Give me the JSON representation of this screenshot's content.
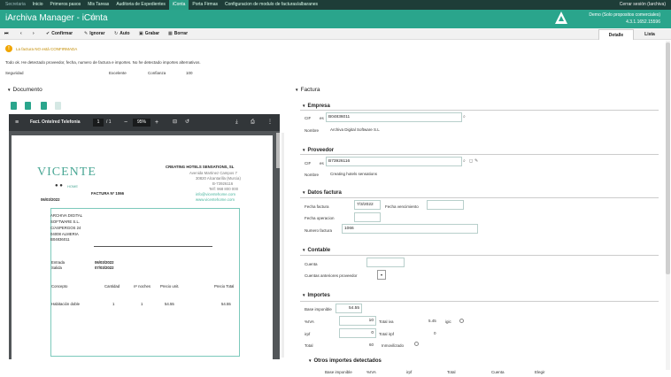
{
  "topnav": {
    "items": [
      "Secretaria",
      "Inicio",
      "Primeros pasos",
      "Mis Tareas",
      "Auditoria de Expedientes",
      "iConta",
      "Porta Firmas",
      "Configuracion de modulo de facturas/albaranes"
    ],
    "active_index": 5,
    "session": "Cerrar sesión (Iarchiva)"
  },
  "header": {
    "title": "iArchiva Manager - iConta",
    "context_line1": "Demo (Solo propositos comerciales)",
    "context_line2": "4.3.1.1652.15596"
  },
  "toolbar": {
    "confirm": "Confirmar",
    "ignore": "Ignorar",
    "auto": "Auto",
    "save": "Grabar",
    "delete": "Borrar",
    "tab_detail": "Detalle",
    "tab_list": "Lista"
  },
  "warning": "La factura NO está CONFIRMADA",
  "info_line": "Todo ok. He detectado proveedor, fecha, numero de factura e importes. No he detectado importes alternativos.",
  "security": {
    "label": "Seguridad",
    "value": "Excelente",
    "confidence_label": "Confianza",
    "confidence_value": "100"
  },
  "document": {
    "heading": "Documento",
    "viewer_title": "Fact. Ontelred Telefonia",
    "page_current": "1",
    "page_total": "/ 1",
    "zoom": "95%"
  },
  "invoice": {
    "logo_text": "VICENTE",
    "logo_sub": "HOME",
    "company_name": "CREATING HOTELS SENSATIONS, SL",
    "company_addr1": "Avenida Martinez Campos 7",
    "company_addr2": "30820 Alcantarilla (Murcia)",
    "company_cif": "B-73926116",
    "company_phone": "Telf: 968 800 000",
    "company_email": "info@vicentehome.com",
    "company_web": "www.vicentehome.com",
    "invoice_label": "FACTURA Nº 1066",
    "invoice_date": "06/03/2022",
    "client_lines": [
      "ARCHIVA DIGITAL",
      "SOFTWARE S.L.",
      "C/ASPERGOS 24",
      "04008 ALMERIA",
      "B04836011"
    ],
    "entry_label": "Entrada",
    "entry_value": "06/03/2022",
    "exit_label": "Salida",
    "exit_value": "07/03/2022",
    "col_concept": "Concepto",
    "col_qty": "Cantidad",
    "col_nights": "nº noches",
    "col_price": "Precio unit.",
    "col_total": "Precio Total",
    "row_concept": "Habitación doble",
    "row_qty": "1",
    "row_nights": "1",
    "row_price": "54.55",
    "row_total": "54.55"
  },
  "factura": {
    "heading": "Factura",
    "empresa": {
      "heading": "Empresa",
      "cif_label": "CIF",
      "cif_prefix": "es",
      "cif_value": "B04836011",
      "name_label": "Nombre",
      "name_value": "Archiva Digital Software S.L"
    },
    "proveedor": {
      "heading": "Proveedor",
      "cif_label": "CIF",
      "cif_prefix": "es",
      "cif_value": "B73926116",
      "name_label": "Nombre",
      "name_value": "Creating hotels sensations"
    },
    "datos": {
      "heading": "Datos factura",
      "date_label": "Fecha factura",
      "date_value": "7/3/2022",
      "due_label": "Fecha vencimiento",
      "due_value": "",
      "op_label": "Fecha operacion",
      "op_value": "",
      "number_label": "Numero factura",
      "number_value": "1066"
    },
    "contable": {
      "heading": "Contable",
      "account_label": "Cuenta",
      "account_value": "",
      "prev_label": "Cuentas anteriores proveedor"
    },
    "importes": {
      "heading": "Importes",
      "base_label": "Base imponible",
      "base_value": "54.55",
      "iva_pct_label": "%IVA",
      "iva_pct_value": "10",
      "iva_total_label": "Total iva",
      "iva_total_value": "5.45",
      "igic_label": "igic",
      "irpf_pct_label": "irpf",
      "irpf_pct_value": "0",
      "irpf_total_label": "Total irpf",
      "irpf_total_value": "0",
      "total_label": "Total",
      "total_value": "60",
      "inmov_label": "Inmovilizado"
    },
    "otros": {
      "heading": "Otros importes detectados",
      "columns": [
        "Base imponible",
        "%IVA",
        "irpf",
        "Total",
        "Cuenta",
        "Elegir"
      ]
    }
  }
}
